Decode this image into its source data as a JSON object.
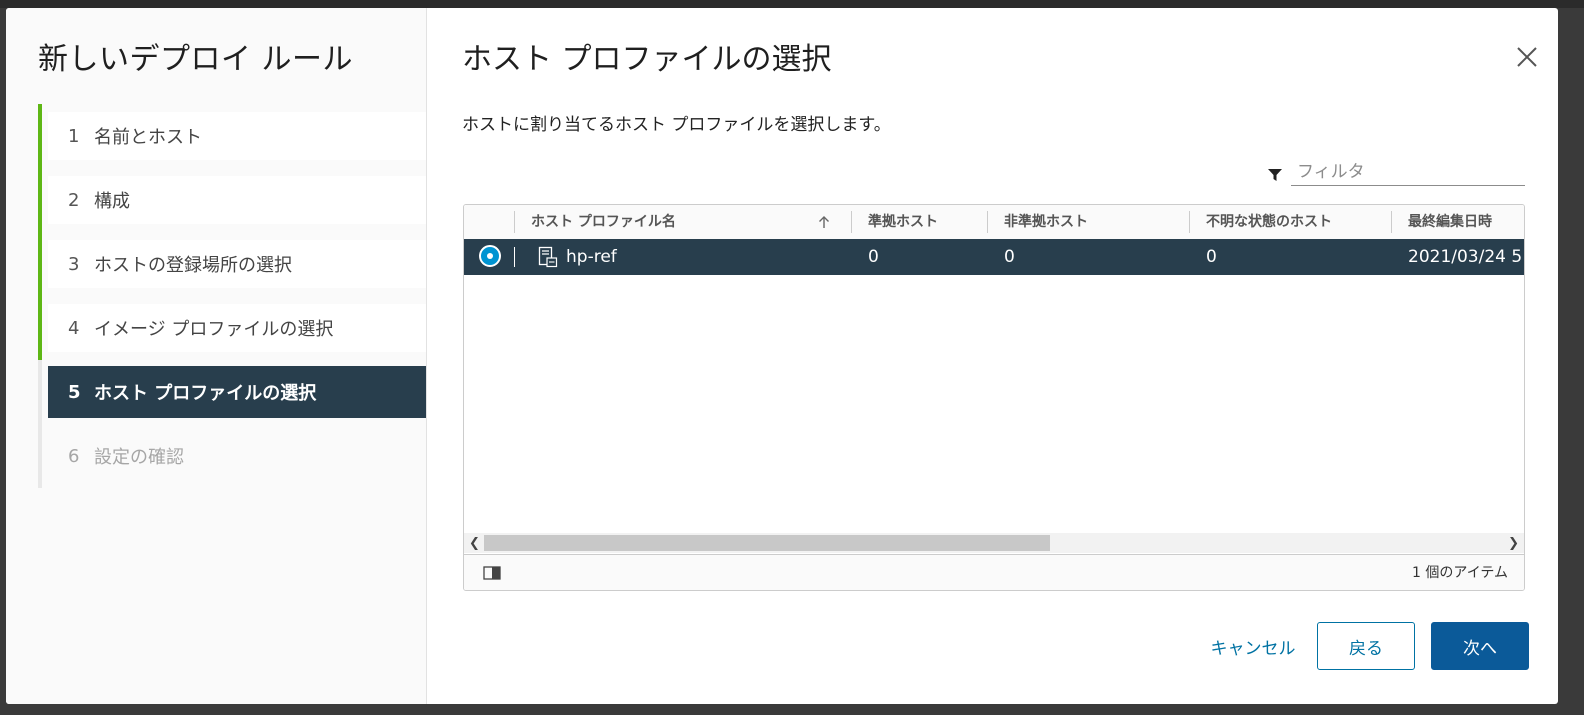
{
  "sidebar": {
    "title": "新しいデプロイ ルール",
    "steps": [
      {
        "num": "1",
        "label": "名前とホスト",
        "state": "done"
      },
      {
        "num": "2",
        "label": "構成",
        "state": "done"
      },
      {
        "num": "3",
        "label": "ホストの登録場所の選択",
        "state": "done"
      },
      {
        "num": "4",
        "label": "イメージ プロファイルの選択",
        "state": "done"
      },
      {
        "num": "5",
        "label": "ホスト プロファイルの選択",
        "state": "active"
      },
      {
        "num": "6",
        "label": "設定の確認",
        "state": "future"
      }
    ]
  },
  "main": {
    "title": "ホスト プロファイルの選択",
    "description": "ホストに割り当てるホスト プロファイルを選択します。",
    "filter_placeholder": "フィルタ",
    "close_icon": "close-icon"
  },
  "grid": {
    "columns": [
      "ホスト プロファイル名",
      "準拠ホスト",
      "非準拠ホスト",
      "不明な状態のホスト",
      "最終編集日時"
    ],
    "sort_icon": "arrow-up-icon",
    "rows": [
      {
        "selected": true,
        "name": "hp-ref",
        "compliant": "0",
        "noncompliant": "0",
        "unknown": "0",
        "last_edited": "2021/03/24 5"
      }
    ],
    "footer_count": "1 個のアイテム"
  },
  "buttons": {
    "cancel": "キャンセル",
    "back": "戻る",
    "next": "次へ"
  },
  "colors": {
    "accent_blue": "#0072a3",
    "primary_button": "#0b5a99",
    "active_step_bg": "#283e4d",
    "step_done_bar": "#5eb715"
  }
}
